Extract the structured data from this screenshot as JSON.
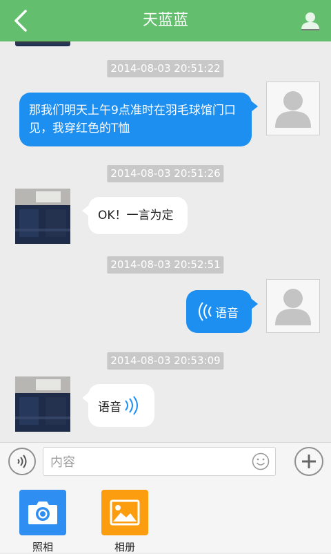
{
  "header": {
    "title": "天蓝蓝",
    "back_icon": "chevron-left-icon",
    "profile_icon": "person-icon"
  },
  "colors": {
    "header_bg": "#63bf6e",
    "outgoing_bubble": "#1d8ff1",
    "incoming_bubble": "#ffffff",
    "timestamp_bg": "#c8c8c8",
    "camera_tile": "#2f8ef2",
    "album_tile": "#fb9d0e"
  },
  "messages": [
    {
      "timestamp": "2014-08-03 20:51:22",
      "direction": "outgoing",
      "type": "text",
      "text": "那我们明天上午9点准时在羽毛球馆门口见，我穿红色的T恤"
    },
    {
      "timestamp": "2014-08-03 20:51:26",
      "direction": "incoming",
      "type": "text",
      "text": "OK！一言为定"
    },
    {
      "timestamp": "2014-08-03 20:52:51",
      "direction": "outgoing",
      "type": "voice",
      "text": "语音"
    },
    {
      "timestamp": "2014-08-03 20:53:09",
      "direction": "incoming",
      "type": "voice",
      "text": "语音"
    }
  ],
  "composer": {
    "placeholder": "内容",
    "voice_icon": "voice-wave-icon",
    "emoji_icon": "smiley-icon",
    "add_icon": "plus-icon"
  },
  "tools": [
    {
      "label": "照相",
      "icon": "camera-icon"
    },
    {
      "label": "相册",
      "icon": "picture-icon"
    }
  ]
}
